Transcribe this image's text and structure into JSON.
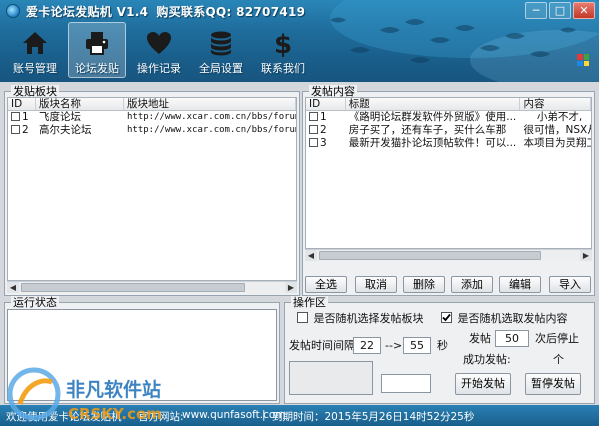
{
  "window": {
    "title": "爱卡论坛发贴机 V1.4",
    "contact": "购买联系QQ: 82707419",
    "controls": [
      "─",
      "□",
      "✕"
    ]
  },
  "toolbar": [
    {
      "label": "账号管理",
      "icon": "home-icon",
      "active": false
    },
    {
      "label": "论坛发贴",
      "icon": "printer-icon",
      "active": true
    },
    {
      "label": "操作记录",
      "icon": "heart-icon",
      "active": false
    },
    {
      "label": "全局设置",
      "icon": "database-icon",
      "active": false
    },
    {
      "label": "联系我们",
      "icon": "dollar-icon",
      "active": false
    }
  ],
  "boards": {
    "legend": "发贴板块",
    "columns": [
      "ID",
      "版块名称",
      "版块地址"
    ],
    "rows": [
      {
        "id": "1",
        "name": "飞度论坛",
        "url": "http://www.xcar.com.cn/bbs/forumdis"
      },
      {
        "id": "2",
        "name": "高尔夫论坛",
        "url": "http://www.xcar.com.cn/bbs/forumdis"
      }
    ]
  },
  "posts": {
    "legend": "发帖内容",
    "columns": [
      "ID",
      "标题",
      "内容"
    ],
    "rows": [
      {
        "id": "1",
        "title": "《路明论坛群发软件外贸版》使用...",
        "content": "    小弟不才,"
      },
      {
        "id": "2",
        "title": "房子买了，还有车子，买什么车那",
        "content": "很可惜，NSX从未"
      },
      {
        "id": "3",
        "title": "最新开发猫扑论坛顶帖软件！可以...",
        "content": "本项目为灵翔工"
      }
    ],
    "buttons": [
      "全选",
      "取消",
      "删除",
      "添加",
      "编辑",
      "导入"
    ]
  },
  "log": {
    "legend": "运行状态"
  },
  "ops": {
    "legend": "操作区",
    "random_board_label": "是否随机选择发帖板块",
    "random_board_checked": false,
    "random_content_label": "是否随机选取发帖内容",
    "random_content_checked": true,
    "post_label": "发帖",
    "post_count": "50",
    "stop_label": "次后停止",
    "interval_label": "发帖时间间隔",
    "interval_min": "22",
    "interval_arrow": "-->",
    "interval_max": "55",
    "interval_unit": "秒",
    "success_label": "成功发帖:",
    "success_unit": "个",
    "start_button": "开始发帖",
    "pause_button": "暂停发帖"
  },
  "status": {
    "left": "欢迎使用爱卡论坛发贴机",
    "site": "www.qunfasoft.com",
    "site_prefix": "官方网站:",
    "expire": "到期时间：2015年5月26日14时52分25秒"
  },
  "watermark": {
    "text": "非凡软件站",
    "sub": "CRSKY.com"
  },
  "colors": {
    "header": "#1f6e9e",
    "status": "#1a5f8c"
  }
}
